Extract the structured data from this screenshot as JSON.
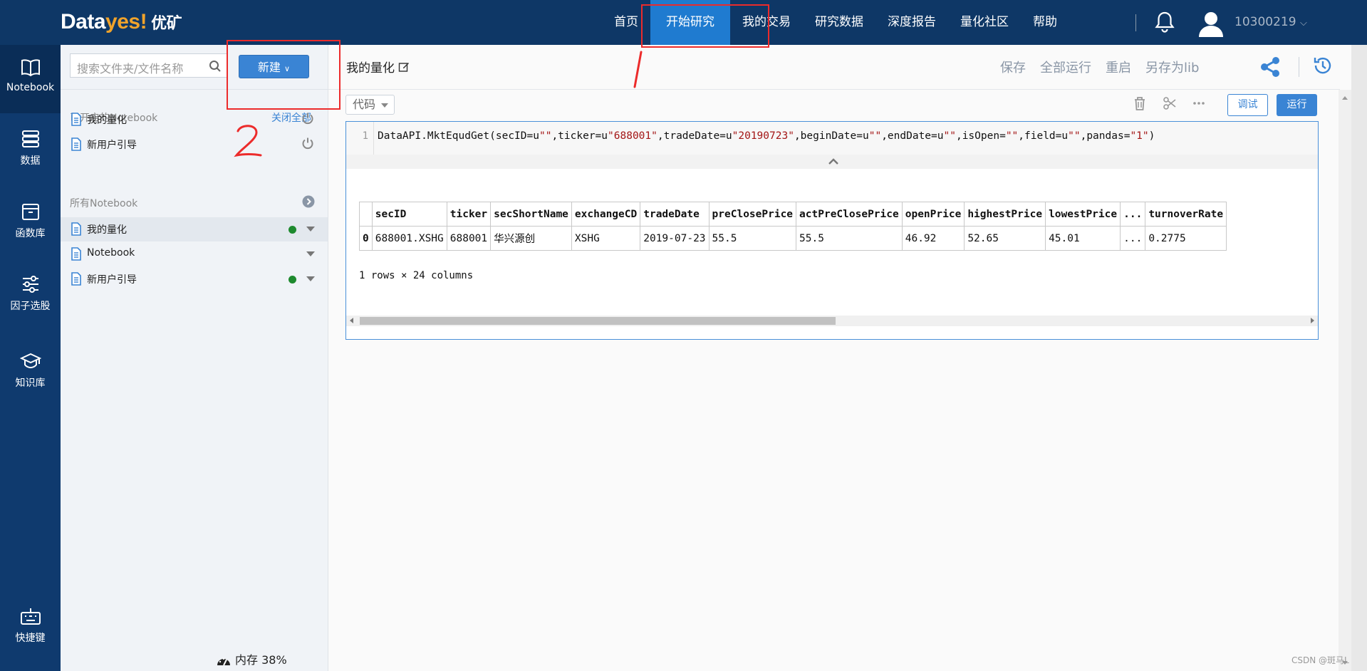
{
  "app": {
    "logo_main": "Data",
    "logo_accent": "yes!",
    "logo_cn": "优矿"
  },
  "topnav": {
    "items": [
      "首页",
      "开始研究",
      "我的交易",
      "研究数据",
      "深度报告",
      "量化社区",
      "帮助"
    ],
    "active": "开始研究",
    "user_id": "10300219",
    "user_chevron": "⌵"
  },
  "sidebar": {
    "items": [
      {
        "label": "Notebook",
        "icon": "book-icon",
        "active": true
      },
      {
        "label": "数据",
        "icon": "database-icon"
      },
      {
        "label": "函数库",
        "icon": "box-icon"
      },
      {
        "label": "因子选股",
        "icon": "sliders-icon"
      },
      {
        "label": "知识库",
        "icon": "graduation-cap-icon"
      },
      {
        "label": "快捷键",
        "icon": "keyboard-icon"
      }
    ]
  },
  "filepanel": {
    "search_placeholder": "搜索文件夹/文件名称",
    "new_button": "新建",
    "opened_label": "已开启的Notebook",
    "close_all": "关闭全部",
    "opened_items": [
      "我的量化",
      "新用户引导"
    ],
    "all_label": "所有Notebook",
    "all_items": [
      {
        "name": "我的量化",
        "running": true
      },
      {
        "name": "Notebook",
        "running": false
      },
      {
        "name": "新用户引导",
        "running": true
      }
    ],
    "memory_label": "内存 38%"
  },
  "notebook": {
    "title": "我的量化",
    "actions": [
      "保存",
      "全部运行",
      "重启",
      "另存为lib"
    ],
    "cell_type": "代码",
    "debug_label": "调试",
    "run_label": "运行",
    "line_number": "1",
    "code_prefix": "DataAPI.MktEqudGet(secID=u",
    "code_parts": [
      {
        "t": "DataAPI.MktEqudGet(secID=u",
        "s": false
      },
      {
        "t": "\"\"",
        "s": true
      },
      {
        "t": ",ticker=u",
        "s": false
      },
      {
        "t": "\"688001\"",
        "s": true
      },
      {
        "t": ",tradeDate=u",
        "s": false
      },
      {
        "t": "\"20190723\"",
        "s": true
      },
      {
        "t": ",beginDate=u",
        "s": false
      },
      {
        "t": "\"\"",
        "s": true
      },
      {
        "t": ",endDate=u",
        "s": false
      },
      {
        "t": "\"\"",
        "s": true
      },
      {
        "t": ",isOpen=",
        "s": false
      },
      {
        "t": "\"\"",
        "s": true
      },
      {
        "t": ",field=u",
        "s": false
      },
      {
        "t": "\"\"",
        "s": true
      },
      {
        "t": ",pandas=",
        "s": false
      },
      {
        "t": "\"1\"",
        "s": true
      },
      {
        "t": ")",
        "s": false
      }
    ],
    "output": {
      "columns": [
        "",
        "secID",
        "ticker",
        "secShortName",
        "exchangeCD",
        "tradeDate",
        "preClosePrice",
        "actPreClosePrice",
        "openPrice",
        "highestPrice",
        "lowestPrice",
        "...",
        "turnoverRate"
      ],
      "rows": [
        [
          "0",
          "688001.XSHG",
          "688001",
          "华兴源创",
          "XSHG",
          "2019-07-23",
          "55.5",
          "55.5",
          "46.92",
          "52.65",
          "45.01",
          "...",
          "0.2775"
        ]
      ],
      "summary": "1 rows × 24 columns"
    }
  },
  "annotations": {
    "mark1": "1",
    "mark2": "2",
    "color": "#ec2b2b"
  },
  "watermark": "CSDN @斑马L"
}
